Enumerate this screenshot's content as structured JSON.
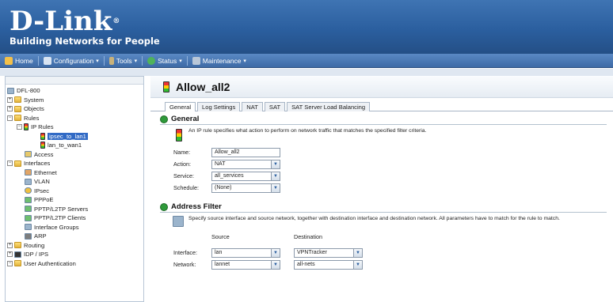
{
  "brand": {
    "logo_text": "D-Link",
    "registered": "®",
    "tagline": "Building Networks for People"
  },
  "navbar": [
    {
      "label": "Home",
      "icon": "home-icon",
      "caret": ""
    },
    {
      "label": "Configuration",
      "icon": "configuration-icon",
      "caret": "▾"
    },
    {
      "label": "Tools",
      "icon": "tools-icon",
      "caret": "▾"
    },
    {
      "label": "Status",
      "icon": "status-icon",
      "caret": "▾"
    },
    {
      "label": "Maintenance",
      "icon": "maintenance-icon",
      "caret": "▾"
    }
  ],
  "tree": [
    {
      "label": "DFL-800",
      "toggle": "",
      "icon": "device-icon",
      "indent": 0
    },
    {
      "label": "System",
      "toggle": "+",
      "icon": "folder-icon",
      "indent": 0
    },
    {
      "label": "Objects",
      "toggle": "+",
      "icon": "folder-icon",
      "indent": 0
    },
    {
      "label": "Rules",
      "toggle": "−",
      "icon": "folder-icon",
      "indent": 0
    },
    {
      "label": "IP Rules",
      "toggle": "−",
      "icon": "traffic-light-icon",
      "indent": 1
    },
    {
      "label": "ipsec_to_lan1",
      "toggle": "",
      "icon": "traffic-light-icon",
      "indent": 2,
      "selected": true
    },
    {
      "label": "lan_to_wan1",
      "toggle": "",
      "icon": "traffic-light-icon",
      "indent": 2
    },
    {
      "label": "Access",
      "toggle": "",
      "icon": "access-icon",
      "indent": 1
    },
    {
      "label": "Interfaces",
      "toggle": "−",
      "icon": "folder-icon",
      "indent": 0
    },
    {
      "label": "Ethernet",
      "toggle": "",
      "icon": "ethernet-icon",
      "indent": 1
    },
    {
      "label": "VLAN",
      "toggle": "",
      "icon": "vlan-icon",
      "indent": 1
    },
    {
      "label": "IPsec",
      "toggle": "",
      "icon": "ipsec-icon",
      "indent": 1
    },
    {
      "label": "PPPoE",
      "toggle": "",
      "icon": "pppoe-icon",
      "indent": 1
    },
    {
      "label": "PPTP/L2TP Servers",
      "toggle": "",
      "icon": "pptp-server-icon",
      "indent": 1
    },
    {
      "label": "PPTP/L2TP Clients",
      "toggle": "",
      "icon": "pptp-client-icon",
      "indent": 1
    },
    {
      "label": "Interface Groups",
      "toggle": "",
      "icon": "interface-group-icon",
      "indent": 1
    },
    {
      "label": "ARP",
      "toggle": "",
      "icon": "arp-icon",
      "indent": 1
    },
    {
      "label": "Routing",
      "toggle": "+",
      "icon": "folder-icon",
      "indent": 0
    },
    {
      "label": "IDP / IPS",
      "toggle": "+",
      "icon": "idp-icon",
      "indent": 0
    },
    {
      "label": "User Authentication",
      "toggle": "−",
      "icon": "folder-icon",
      "indent": 0
    }
  ],
  "page": {
    "title": "Allow_all2",
    "tabs": [
      "General",
      "Log Settings",
      "NAT",
      "SAT",
      "SAT Server Load Balancing"
    ],
    "active_tab": "General"
  },
  "general": {
    "heading": "General",
    "description": "An IP rule specifies what action to perform on network traffic that matches the specified filter criteria.",
    "name_label": "Name:",
    "name_value": "Allow_all2",
    "action_label": "Action:",
    "action_value": "NAT",
    "service_label": "Service:",
    "service_value": "all_services",
    "schedule_label": "Schedule:",
    "schedule_value": "(None)"
  },
  "address_filter": {
    "heading": "Address Filter",
    "description": "Specify source interface and source network, together with destination interface and destination network. All parameters have to match for the rule to match.",
    "source_header": "Source",
    "destination_header": "Destination",
    "interface_label": "Interface:",
    "source_interface": "lan",
    "destination_interface": "VPNTracker",
    "network_label": "Network:",
    "source_network": "lannet",
    "destination_network": "all-nets"
  },
  "colors": {
    "header": "#2b5f9f",
    "navbar": "#3d6aa6",
    "selection": "#316ac5"
  }
}
